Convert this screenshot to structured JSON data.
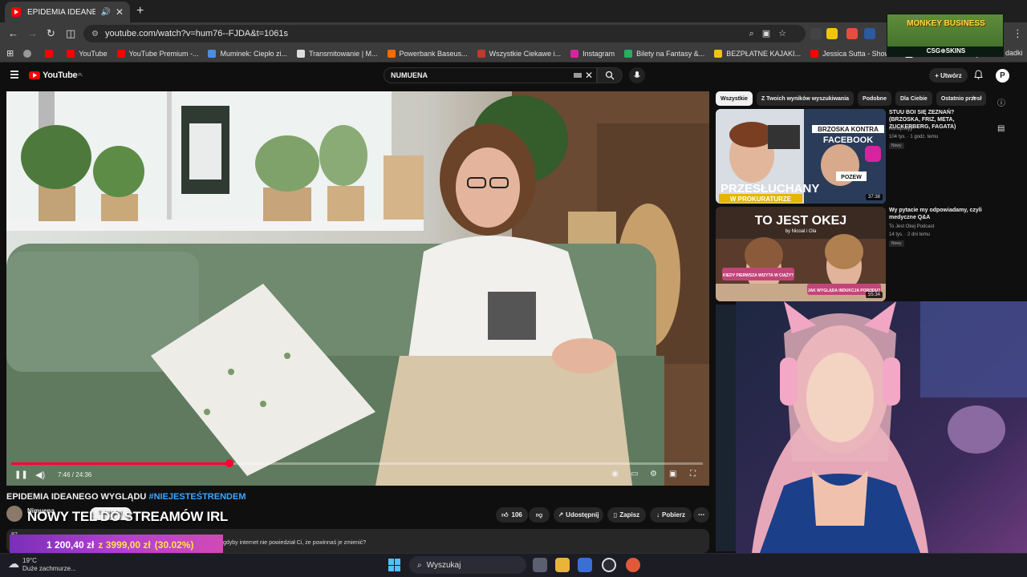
{
  "browser": {
    "tab_title": "EPIDEMIA IDEANEGO WYGLĄDU",
    "url": "youtube.com/watch?v=hum76--FJDA&t=1061s",
    "bookmarks": [
      {
        "label": "YouTube",
        "color": "#ff0000"
      },
      {
        "label": "YouTube Premium -...",
        "color": "#ff0000"
      },
      {
        "label": "Muminek: Ciepło zi...",
        "color": "#4a90e2"
      },
      {
        "label": "Transmitowanie | M...",
        "color": "#dddddd"
      },
      {
        "label": "Powerbank Baseus...",
        "color": "#ff6a00"
      },
      {
        "label": "Wszystkie Ciekawe i...",
        "color": "#c0392b"
      },
      {
        "label": "Instagram",
        "color": "#d6249f"
      },
      {
        "label": "Bilety na Fantasy &...",
        "color": "#27ae60"
      },
      {
        "label": "BEZPŁATNE KAJAKI...",
        "color": "#f1c40f"
      },
      {
        "label": "Jessica Sutta - Show...",
        "color": "#ff0000"
      },
      {
        "label": "Koszulki na wakacje...",
        "color": "#ffffff"
      }
    ],
    "bookmarks_tail": "dadki"
  },
  "ad": {
    "title": "MONKEY BUSINESS",
    "footer": "CSG⊕SKINS"
  },
  "youtube": {
    "logo": "YouTube",
    "logo_region": "PL",
    "search_value": "NUMUENA",
    "create_label": "Utwórz",
    "avatar_letter": "P"
  },
  "player": {
    "time_current": "7:46",
    "time_total": "24:36",
    "time_display": "7:46 / 24:36",
    "progress_fraction": 0.316
  },
  "video": {
    "title_main": "EPIDEMIA IDEANEGO WYGLĄDU",
    "title_tag": "#NIEJESTEŚTRENDEM",
    "channel": "Nimuena",
    "subscribe_label": "Subskrybuj",
    "overlay_title": "NOWY TEL DO STREAMÓW IRL",
    "likes": "106",
    "share_label": "Udostępnij",
    "save_label": "Zapisz",
    "download_label": "Pobierz",
    "desc_views": "87",
    "desc_text": "A c",
    "desc_line": "y Ci, gdyby internet nie powiedział Ci, że powinnaś je zmienić?"
  },
  "donation": {
    "current": "1 200,40 zł",
    "goal": "z 3999,00 zł",
    "percent": "(30.02%)",
    "fraction": 0.3002
  },
  "chips": [
    "Wszystkie",
    "Z Twoich wyników wyszukiwania",
    "Podobne",
    "Dla Ciebie",
    "Ostatnio przesł"
  ],
  "recommendations": [
    {
      "title": "STUU BOI SIĘ ZEZNAŃ? (BRZOSKA, FRIZ, META, ZUCKERBERG, FAGATA)",
      "channel": "Konopskyy",
      "meta": "104 tys. · 1 godz. temu",
      "badge": "Nowy",
      "duration": "37:38",
      "thumb_top": "BRZOSKA KONTRA",
      "thumb_brand": "FACEBOOK",
      "thumb_big": "PRZESŁUCHANY",
      "thumb_sub": "W PROKURATURZE",
      "thumb_sign": "POZEW"
    },
    {
      "title": "Wy pytacie my odpowiadamy, czyli medyczne Q&A",
      "channel": "To Jest Okej Podcast",
      "meta": "14 tys. · 2 dni temu",
      "badge": "Nowy",
      "duration": "55:34",
      "thumb_top": "TO JEST OKEJ",
      "thumb_sub": "by Nicoal i Ola",
      "thumb_q1": "KIEDY PIERWSZA WIZYTA W CIĄŻY?",
      "thumb_q2": "JAK WYGLĄDA INDUKCJA PORODU?"
    }
  ],
  "taskbar": {
    "temperature": "19°C",
    "weather": "Duże zachmurze...",
    "search_label": "Wyszukaj"
  }
}
